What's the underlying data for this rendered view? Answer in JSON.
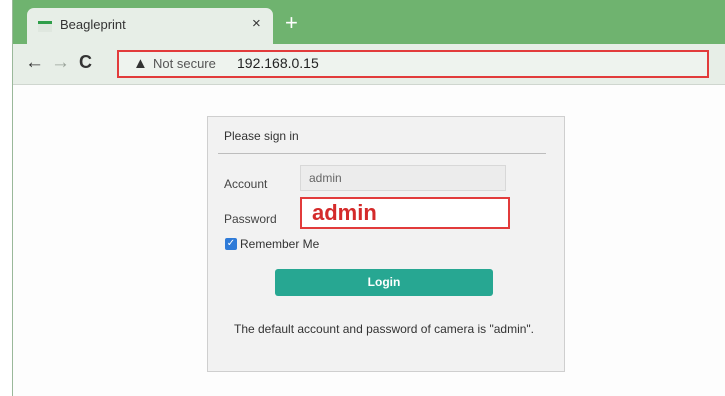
{
  "browser": {
    "tab_title": "Beagleprint",
    "tab_close": "×",
    "new_tab": "+",
    "back_icon": "←",
    "forward_icon": "→",
    "reload_icon": "C",
    "security_icon": "▲",
    "security_label": "Not secure",
    "url": "192.168.0.15",
    "highlight_color": "#e23b3b"
  },
  "login": {
    "title": "Please sign in",
    "account_label": "Account",
    "account_value": "admin",
    "password_label": "Password",
    "password_value": "admin",
    "remember_label": "Remember Me",
    "remember_checked": true,
    "button_label": "Login",
    "button_color": "#27a792",
    "note": "The default account and password of camera is \"admin\"."
  }
}
